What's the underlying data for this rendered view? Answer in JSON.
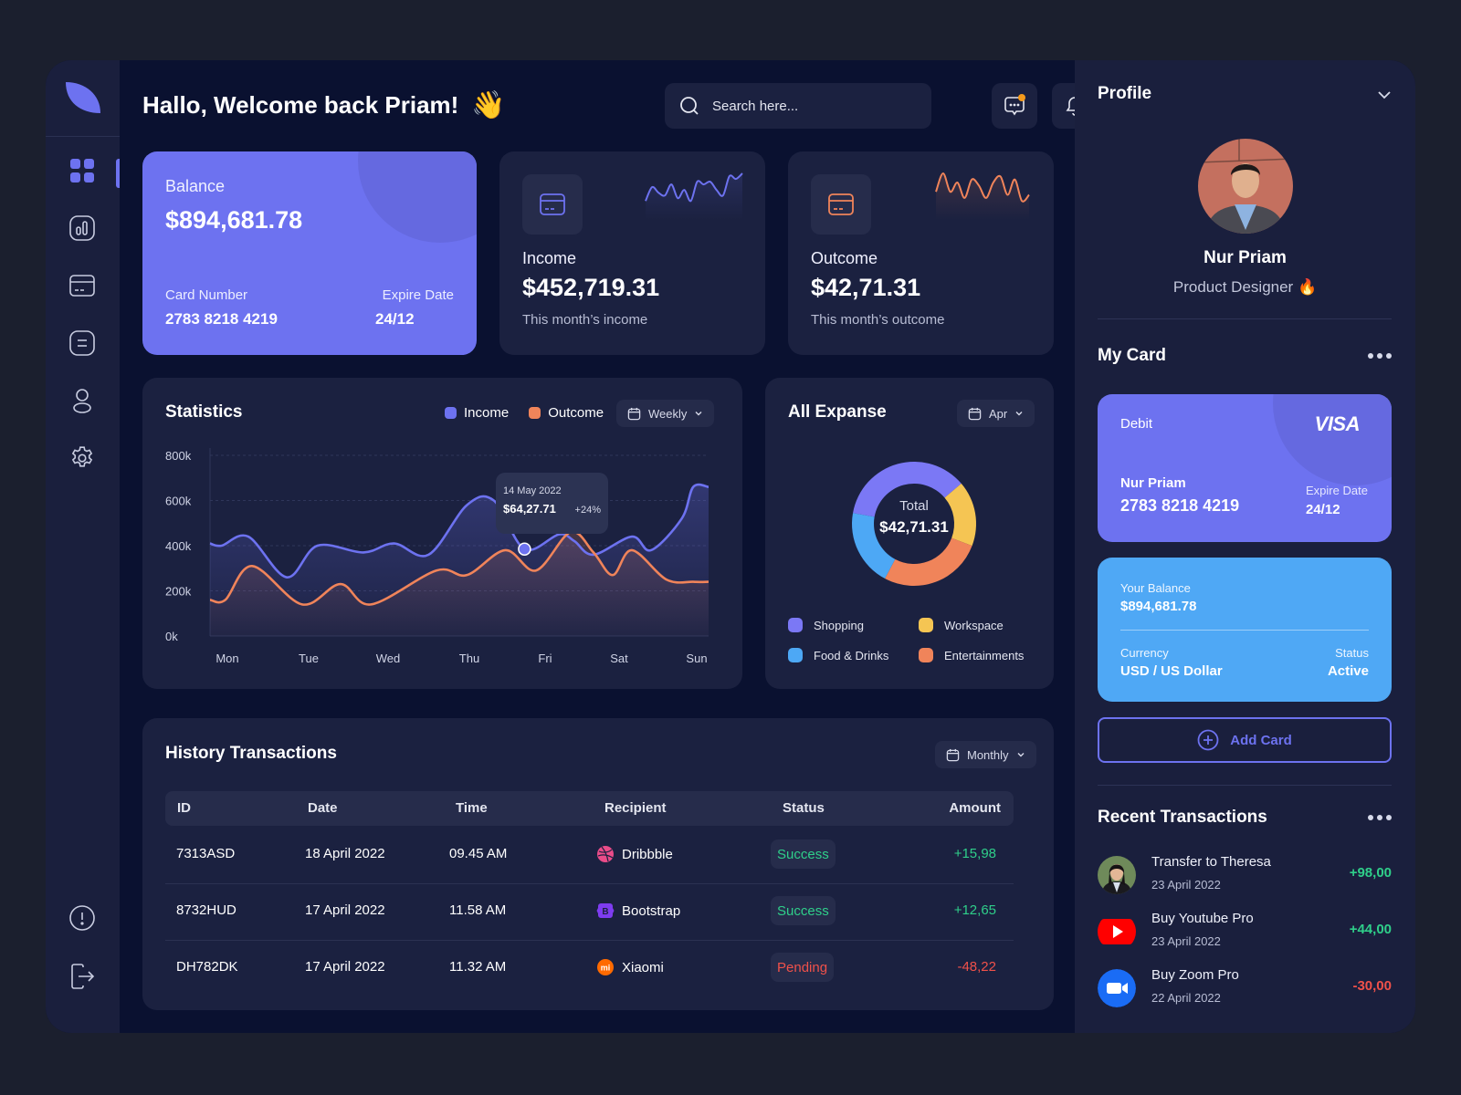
{
  "header": {
    "greeting": "Hallo, Welcome back Priam!",
    "greeting_emoji": "👋",
    "search_placeholder": "Search here...",
    "icons": [
      "search-icon",
      "message-icon",
      "bell-icon"
    ]
  },
  "sidebar": {
    "items": [
      {
        "name": "dashboard",
        "icon": "grid-icon",
        "active": true
      },
      {
        "name": "analytics",
        "icon": "chart-icon",
        "active": false
      },
      {
        "name": "cards",
        "icon": "credit-card-icon",
        "active": false
      },
      {
        "name": "documents",
        "icon": "document-icon",
        "active": false
      },
      {
        "name": "profile",
        "icon": "user-icon",
        "active": false
      },
      {
        "name": "settings",
        "icon": "gear-icon",
        "active": false
      }
    ],
    "bottom": [
      {
        "name": "help",
        "icon": "alert-circle-icon"
      },
      {
        "name": "logout",
        "icon": "logout-icon"
      }
    ]
  },
  "balance_card": {
    "label": "Balance",
    "amount": "$894,681.78",
    "card_number_label": "Card Number",
    "card_number": "2783 8218 4219",
    "expire_label": "Expire Date",
    "expire": "24/12"
  },
  "income_card": {
    "label": "Income",
    "amount": "$452,719.31",
    "sub": "This month’s income",
    "color": "#6d72f0"
  },
  "outcome_card": {
    "label": "Outcome",
    "amount": "$42,71.31",
    "sub": "This month’s outcome",
    "color": "#f0845a"
  },
  "statistics": {
    "title": "Statistics",
    "legend": [
      {
        "label": "Income",
        "color": "#6d72f0"
      },
      {
        "label": "Outcome",
        "color": "#f0845a"
      }
    ],
    "period": "Weekly",
    "tooltip": {
      "date": "14 May 2022",
      "amount": "$64,27.71",
      "change": "+24%"
    }
  },
  "chart_data": [
    {
      "type": "line",
      "title": "Statistics",
      "x": [
        "Mon",
        "Tue",
        "Wed",
        "Thu",
        "Fri",
        "Sat",
        "Sun"
      ],
      "yticks": [
        "0k",
        "200k",
        "400k",
        "600k",
        "800k"
      ],
      "ylim": [
        0,
        800
      ],
      "grid": true,
      "legend": "top-right",
      "series": [
        {
          "name": "Income",
          "color": "#6d72f0",
          "x": [
            0,
            0.15,
            0.5,
            1.0,
            1.4,
            2.0,
            2.4,
            2.85,
            3.35,
            3.7,
            4.1,
            4.55,
            4.75,
            5.0,
            5.5,
            5.75,
            6.15,
            6.3,
            6.5
          ],
          "values": [
            410,
            400,
            440,
            260,
            400,
            370,
            410,
            360,
            580,
            600,
            385,
            450,
            420,
            360,
            440,
            380,
            520,
            660,
            660
          ]
        },
        {
          "name": "Outcome",
          "color": "#f0845a",
          "x": [
            0,
            0.2,
            0.55,
            1.2,
            1.7,
            2.1,
            2.95,
            3.35,
            3.85,
            4.25,
            4.7,
            5.0,
            5.25,
            5.5,
            5.95,
            6.3,
            6.5
          ],
          "values": [
            160,
            160,
            310,
            140,
            230,
            140,
            290,
            270,
            380,
            290,
            460,
            370,
            270,
            380,
            250,
            240,
            240
          ]
        }
      ],
      "highlight": {
        "x": 4.1,
        "value": 385,
        "series": "Income"
      }
    },
    {
      "type": "pie",
      "title": "All Expanse",
      "center_label": "Total",
      "center_value": "$42,71.31",
      "period": "Apr",
      "slices": [
        {
          "label": "Shopping",
          "value": 36,
          "color": "#7b78f5"
        },
        {
          "label": "Workspace",
          "value": 17,
          "color": "#f5c553"
        },
        {
          "label": "Entertainments",
          "value": 27,
          "color": "#f0845a"
        },
        {
          "label": "Food & Drinks",
          "value": 20,
          "color": "#4da8f5"
        }
      ]
    },
    {
      "type": "line",
      "title": "Income sparkline",
      "values": [
        3,
        8,
        6,
        5,
        9,
        4,
        7,
        3,
        10,
        9,
        10,
        7,
        5,
        12,
        11,
        13
      ],
      "color": "#6d72f0"
    },
    {
      "type": "line",
      "title": "Outcome sparkline",
      "values": [
        6,
        12,
        6,
        9,
        4,
        10,
        8,
        4,
        9,
        11,
        5,
        10,
        3,
        5
      ],
      "color": "#f0845a"
    }
  ],
  "expanse": {
    "title": "All Expanse",
    "period": "Apr",
    "total_label": "Total",
    "total": "$42,71.31",
    "legend": [
      {
        "label": "Shopping",
        "color": "#7b78f5"
      },
      {
        "label": "Workspace",
        "color": "#f5c553"
      },
      {
        "label": "Food & Drinks",
        "color": "#4da8f5"
      },
      {
        "label": "Entertainments",
        "color": "#f0845a"
      }
    ]
  },
  "history": {
    "title": "History Transactions",
    "period": "Monthly",
    "columns": [
      "ID",
      "Date",
      "Time",
      "Recipient",
      "Status",
      "Amount"
    ],
    "rows": [
      {
        "id": "7313ASD",
        "date": "18 April 2022",
        "time": "09.45 AM",
        "recipient": "Dribbble",
        "icon": "dribbble-icon",
        "status": "Success",
        "amount": "+15,98"
      },
      {
        "id": "8732HUD",
        "date": "17 April 2022",
        "time": "11.58 AM",
        "recipient": "Bootstrap",
        "icon": "bootstrap-icon",
        "status": "Success",
        "amount": "+12,65"
      },
      {
        "id": "DH782DK",
        "date": "17 April 2022",
        "time": "11.32 AM",
        "recipient": "Xiaomi",
        "icon": "xiaomi-icon",
        "status": "Pending",
        "amount": "-48,22"
      }
    ],
    "colors": {
      "positive": "#2fcf8a",
      "negative": "#f0514a"
    }
  },
  "profile": {
    "title": "Profile",
    "name": "Nur Priam",
    "role": "Product Designer",
    "role_emoji": "🔥"
  },
  "my_card": {
    "title": "My Card",
    "type": "Debit",
    "brand": "VISA",
    "holder": "Nur Priam",
    "number": "2783 8218 4219",
    "expire_label": "Expire Date",
    "expire": "24/12",
    "balance_label": "Your Balance",
    "balance": "$894,681.78",
    "currency_label": "Currency",
    "currency": "USD / US Dollar",
    "status_label": "Status",
    "status": "Active",
    "add_card": "Add Card"
  },
  "recent": {
    "title": "Recent Transactions",
    "items": [
      {
        "title": "Transfer to Theresa",
        "date": "23 April 2022",
        "amount": "+98,00",
        "icon": "avatar-theresa"
      },
      {
        "title": "Buy Youtube Pro",
        "date": "23 April 2022",
        "amount": "+44,00",
        "icon": "youtube-icon"
      },
      {
        "title": "Buy Zoom Pro",
        "date": "22 April 2022",
        "amount": "-30,00",
        "icon": "zoom-icon"
      }
    ]
  }
}
